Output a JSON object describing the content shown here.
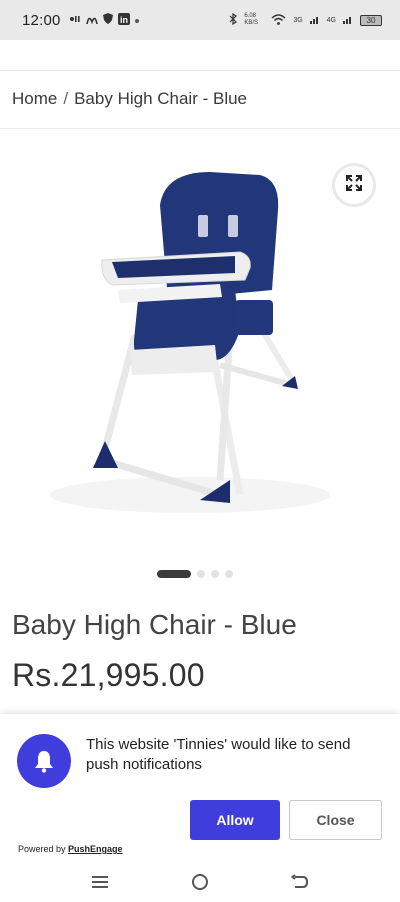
{
  "status_bar": {
    "time": "12:00",
    "network_speed": "6.08 KB/S",
    "network_3g": "3G",
    "network_4g": "4G",
    "battery": "30",
    "icons": [
      "signal-notification-icon",
      "mcdonalds-icon",
      "shield-icon",
      "linkedin-icon",
      "dot-icon",
      "bluetooth-icon",
      "wifi-icon",
      "cellular-icon",
      "cellular-icon-2",
      "battery-icon"
    ]
  },
  "breadcrumb": {
    "home": "Home",
    "separator": "/",
    "current": "Baby High Chair - Blue"
  },
  "product": {
    "title": "Baby High Chair - Blue",
    "price": "Rs.21,995.00",
    "image_icon": "baby-high-chair-image",
    "zoom_icon": "expand-icon",
    "gallery": {
      "count": 4,
      "active_index": 0
    }
  },
  "push_prompt": {
    "message": "This website 'Tinnies' would like to send push notifications",
    "allow_label": "Allow",
    "close_label": "Close",
    "powered_prefix": "Powered by",
    "powered_link": "PushEngage",
    "accent_color": "#3f3ddc",
    "icon": "bell-icon"
  },
  "nav_bar": {
    "icons": [
      "menu-icon",
      "home-circle-icon",
      "back-icon"
    ]
  }
}
